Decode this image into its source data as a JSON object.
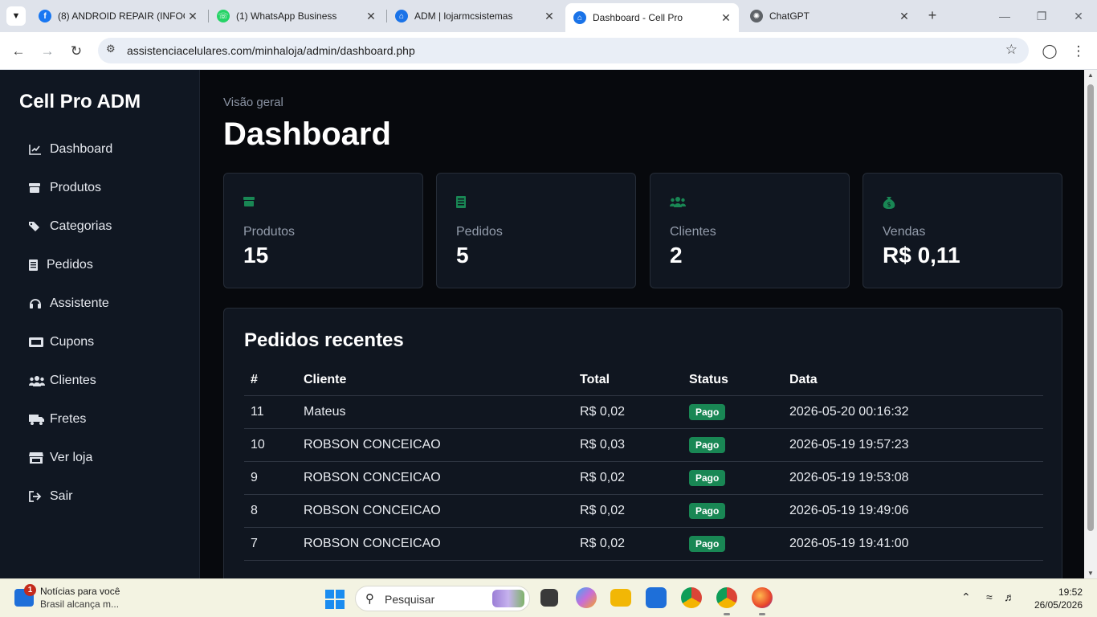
{
  "browser": {
    "tabs": [
      {
        "title": "(8) ANDROID REPAIR (INFOC",
        "favicon": "facebook-icon",
        "color": "#1877f2",
        "active": false
      },
      {
        "title": "(1) WhatsApp Business",
        "favicon": "whatsapp-icon",
        "color": "#25d366",
        "active": false
      },
      {
        "title": "ADM | lojarmcsistemas",
        "favicon": "home-icon",
        "color": "#1a73e8",
        "active": false
      },
      {
        "title": "Dashboard - Cell Pro",
        "favicon": "home-icon",
        "color": "#1a73e8",
        "active": true
      },
      {
        "title": "ChatGPT",
        "favicon": "chatgpt-icon",
        "color": "#444444",
        "active": false
      }
    ],
    "url": "assistenciacelulares.com/minhaloja/admin/dashboard.php"
  },
  "sidebar": {
    "brand": "Cell Pro ADM",
    "items": [
      {
        "label": "Dashboard",
        "icon": "chart-line-icon"
      },
      {
        "label": "Produtos",
        "icon": "box-icon"
      },
      {
        "label": "Categorias",
        "icon": "tags-icon"
      },
      {
        "label": "Pedidos",
        "icon": "receipt-icon"
      },
      {
        "label": "Assistente",
        "icon": "headset-icon"
      },
      {
        "label": "Cupons",
        "icon": "ticket-icon"
      },
      {
        "label": "Clientes",
        "icon": "users-icon"
      },
      {
        "label": "Fretes",
        "icon": "truck-icon"
      },
      {
        "label": "Ver loja",
        "icon": "store-icon"
      },
      {
        "label": "Sair",
        "icon": "logout-icon"
      }
    ]
  },
  "header": {
    "eyebrow": "Visão geral",
    "title": "Dashboard"
  },
  "stats": [
    {
      "label": "Produtos",
      "value": "15",
      "icon": "box-icon"
    },
    {
      "label": "Pedidos",
      "value": "5",
      "icon": "receipt-icon"
    },
    {
      "label": "Clientes",
      "value": "2",
      "icon": "users-icon"
    },
    {
      "label": "Vendas",
      "value": "R$ 0,11",
      "icon": "money-bag-icon"
    }
  ],
  "accent_color": "#198754",
  "orders": {
    "title": "Pedidos recentes",
    "columns": [
      "#",
      "Cliente",
      "Total",
      "Status",
      "Data"
    ],
    "rows": [
      {
        "id": "11",
        "cliente": "Mateus",
        "total": "R$ 0,02",
        "status": "Pago",
        "data": "2026-05-20 00:16:32"
      },
      {
        "id": "10",
        "cliente": "ROBSON CONCEICAO",
        "total": "R$ 0,03",
        "status": "Pago",
        "data": "2026-05-19 19:57:23"
      },
      {
        "id": "9",
        "cliente": "ROBSON CONCEICAO",
        "total": "R$ 0,02",
        "status": "Pago",
        "data": "2026-05-19 19:53:08"
      },
      {
        "id": "8",
        "cliente": "ROBSON CONCEICAO",
        "total": "R$ 0,02",
        "status": "Pago",
        "data": "2026-05-19 19:49:06"
      },
      {
        "id": "7",
        "cliente": "ROBSON CONCEICAO",
        "total": "R$ 0,02",
        "status": "Pago",
        "data": "2026-05-19 19:41:00"
      }
    ]
  },
  "taskbar": {
    "news_badge": "1",
    "news_title": "Notícias para você",
    "news_sub": "Brasil alcança m...",
    "search_placeholder": "Pesquisar",
    "time": "19:52",
    "date": "26/05/2026"
  }
}
